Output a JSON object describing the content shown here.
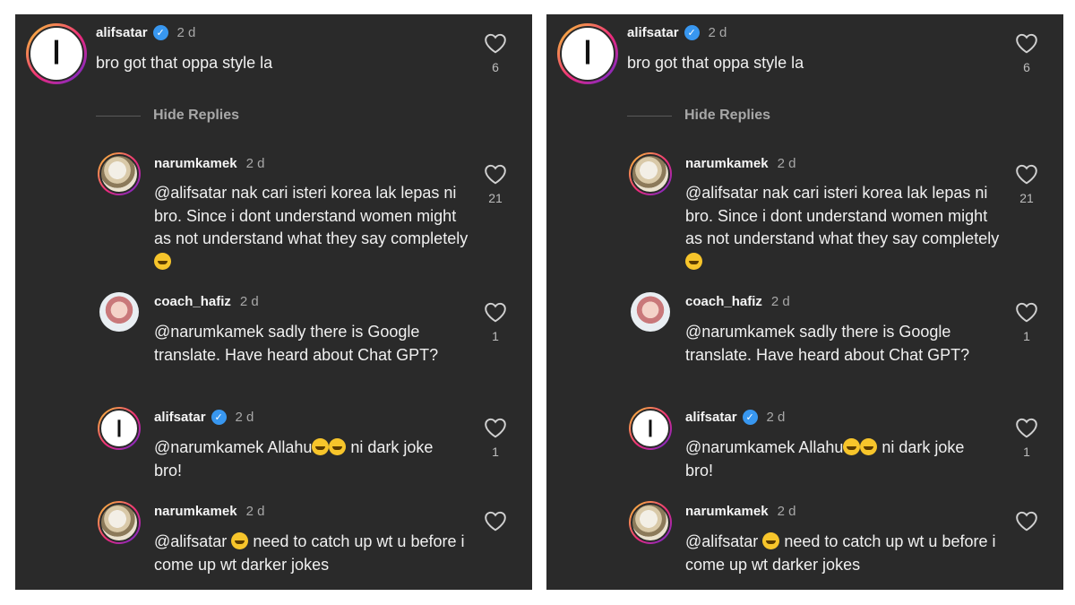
{
  "comments": [
    {
      "username": "alifsatar",
      "verified": true,
      "time": "2 d",
      "text": "bro got that oppa style la",
      "likes": "6",
      "avatar_glyph": "ا"
    },
    {
      "username": "narumkamek",
      "verified": false,
      "time": "2 d",
      "text": "@alifsatar nak cari isteri korea lak lepas ni bro. Since i dont understand women might as not understand what they say completely",
      "likes": "21"
    },
    {
      "username": "coach_hafiz",
      "verified": false,
      "time": "2 d",
      "text": "@narumkamek sadly there is Google translate. Have heard about Chat GPT?",
      "likes": "1"
    },
    {
      "username": "alifsatar",
      "verified": true,
      "time": "2 d",
      "text_before": "@narumkamek Allahu",
      "text_after": " ni dark joke bro!",
      "likes": "1",
      "avatar_glyph": "ا"
    },
    {
      "username": "narumkamek",
      "verified": false,
      "time": "2 d",
      "text_before": "@alifsatar",
      "text_after": " need to catch up wt u before i come up wt darker jokes",
      "likes": ""
    }
  ],
  "hide_replies": "Hide Replies",
  "verified_mark": "✓",
  "icons": {
    "like": "heart-outline-icon",
    "verified": "verified-badge-icon"
  },
  "colors": {
    "background": "#2a2a2a",
    "verified": "#3897f0"
  }
}
